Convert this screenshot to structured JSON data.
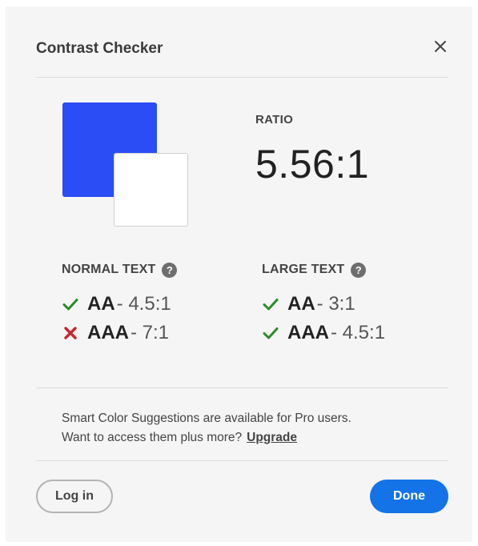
{
  "dialog": {
    "title": "Contrast Checker",
    "close_icon": "close-icon"
  },
  "swatches": {
    "foreground_color": "#2b4df5",
    "background_color": "#ffffff"
  },
  "ratio": {
    "label": "RATIO",
    "value": "5.56:1"
  },
  "normal_text": {
    "heading": "NORMAL TEXT",
    "help_glyph": "?",
    "results": [
      {
        "level": "AA",
        "requirement": "- 4.5:1",
        "pass": true
      },
      {
        "level": "AAA",
        "requirement": "- 7:1",
        "pass": false
      }
    ]
  },
  "large_text": {
    "heading": "LARGE TEXT",
    "help_glyph": "?",
    "results": [
      {
        "level": "AA",
        "requirement": "- 3:1",
        "pass": true
      },
      {
        "level": "AAA",
        "requirement": "- 4.5:1",
        "pass": true
      }
    ]
  },
  "promo": {
    "line1": "Smart Color Suggestions are available for Pro users.",
    "line2": "Want to access them plus more?",
    "link": "Upgrade"
  },
  "footer": {
    "login_label": "Log in",
    "done_label": "Done"
  },
  "colors": {
    "pass": "#2d8a2d",
    "fail": "#c9252d",
    "accent": "#1473e6"
  }
}
